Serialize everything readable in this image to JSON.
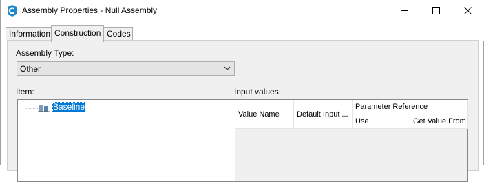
{
  "window": {
    "title": "Assembly Properties - Null Assembly",
    "icon": "civil3d-app-icon",
    "controls": {
      "minimize": "minimize-icon",
      "maximize": "maximize-icon",
      "close": "close-icon"
    }
  },
  "tabs": [
    {
      "label": "Information",
      "active": false
    },
    {
      "label": "Construction",
      "active": true
    },
    {
      "label": "Codes",
      "active": false
    }
  ],
  "construction": {
    "assembly_type_label": "Assembly Type:",
    "assembly_type_value": "Other",
    "item_label": "Item:",
    "tree": [
      {
        "label": "Baseline",
        "selected": true
      }
    ],
    "input_values_label": "Input values:",
    "grid_headers": {
      "value_name": "Value Name",
      "default_input": "Default Input ...",
      "parameter_reference": "Parameter Reference",
      "use": "Use",
      "get_value_from": "Get Value From"
    }
  },
  "colors": {
    "selection": "#0078d7",
    "app_icon": "#1e88c9",
    "panel_bg": "#f0f0f0"
  }
}
